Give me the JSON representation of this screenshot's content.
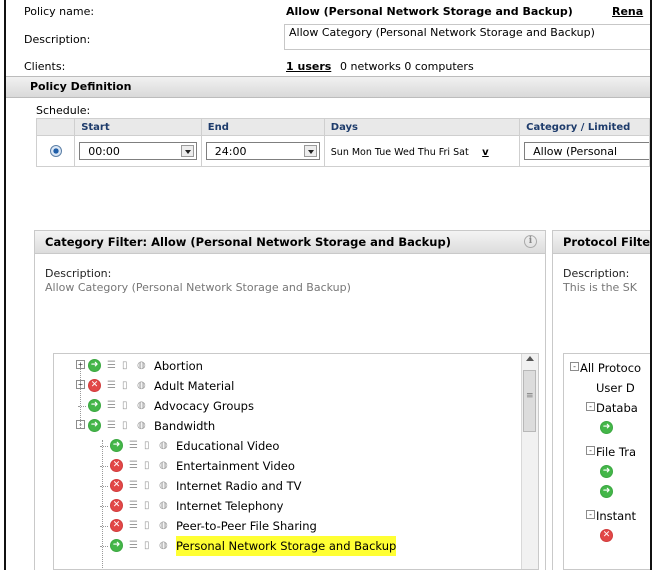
{
  "policy": {
    "name_label": "Policy name:",
    "name_value": "Allow (Personal Network Storage and Backup)",
    "rename_link": "Rena",
    "description_label": "Description:",
    "description_value": "Allow Category (Personal Network Storage and Backup)",
    "clients_label": "Clients:",
    "clients_users": "1 users",
    "clients_rest": "0 networks  0 computers"
  },
  "section": {
    "title": "Policy Definition"
  },
  "schedule": {
    "label": "Schedule:",
    "headers": [
      "Start",
      "End",
      "Days",
      "Category / Limited"
    ],
    "start": "00:00",
    "end": "24:00",
    "days": "Sun Mon Tue Wed Thu Fri Sat",
    "days_more": "v",
    "category": "Allow (Personal"
  },
  "category_filter": {
    "title": "Category Filter: Allow (Personal Network Storage and Backup)",
    "info": "i",
    "desc_label": "Description:",
    "desc_value": "Allow Category (Personal Network Storage and Backup)",
    "tree": [
      {
        "label": "Abortion",
        "status": "allow",
        "expander": "+"
      },
      {
        "label": "Adult Material",
        "status": "deny",
        "expander": "+"
      },
      {
        "label": "Advocacy Groups",
        "status": "allow",
        "expander": ""
      },
      {
        "label": "Bandwidth",
        "status": "allow",
        "expander": "-"
      },
      {
        "label": "Educational Video",
        "status": "allow",
        "expander": ""
      },
      {
        "label": "Entertainment Video",
        "status": "deny",
        "expander": ""
      },
      {
        "label": "Internet Radio and TV",
        "status": "deny",
        "expander": ""
      },
      {
        "label": "Internet Telephony",
        "status": "deny",
        "expander": ""
      },
      {
        "label": "Peer-to-Peer File Sharing",
        "status": "deny",
        "expander": ""
      },
      {
        "label": "Personal Network Storage and Backup",
        "status": "allow",
        "expander": "",
        "highlighted": true
      }
    ]
  },
  "protocol_filter": {
    "title": "Protocol Filter",
    "desc_label": "Description:",
    "desc_value": "This is the SK",
    "tree": [
      "All Protoco",
      "User D",
      "Databa",
      "File Tra",
      "Instant"
    ]
  }
}
